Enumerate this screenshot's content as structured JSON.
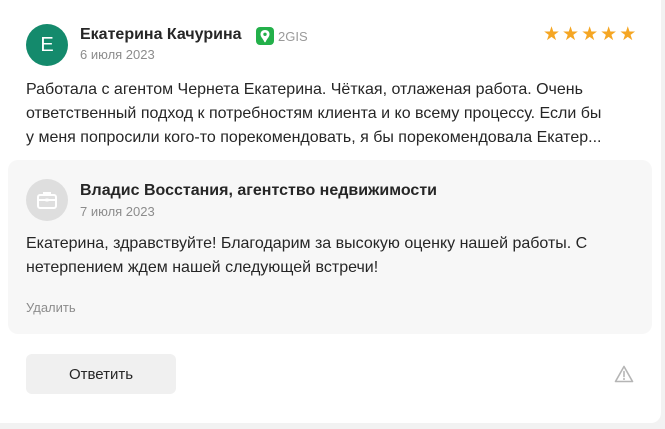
{
  "review": {
    "author_initial": "Е",
    "author_name": "Екатерина Качурина",
    "source_label": "2GIS",
    "date": "6 июля 2023",
    "rating": 5,
    "text_lines": [
      "Работала с агентом Чернета Екатерина. Чёткая, отлаженая работа. Очень",
      "ответственный подход к потребностям клиента и ко всему процессу. Если бы",
      "у меня попросили кого-то порекомендовать, я бы порекомендовала Екатер..."
    ]
  },
  "reply": {
    "org_name": "Владис Восстания, агентство недвижимости",
    "date": "7 июля 2023",
    "text_lines": [
      "Екатерина, здравствуйте! Благодарим за высокую оценку нашей работы. С",
      "нетерпением ждем нашей следующей встречи!"
    ],
    "delete_label": "Удалить"
  },
  "actions": {
    "answer_label": "Ответить"
  },
  "colors": {
    "avatar_bg": "#148a6c",
    "star": "#f5a623",
    "source_logo": "#23b04a"
  },
  "icons": {
    "stars": "star-icon",
    "org": "briefcase-icon",
    "source": "2gis-logo-icon",
    "report": "warning-icon"
  }
}
